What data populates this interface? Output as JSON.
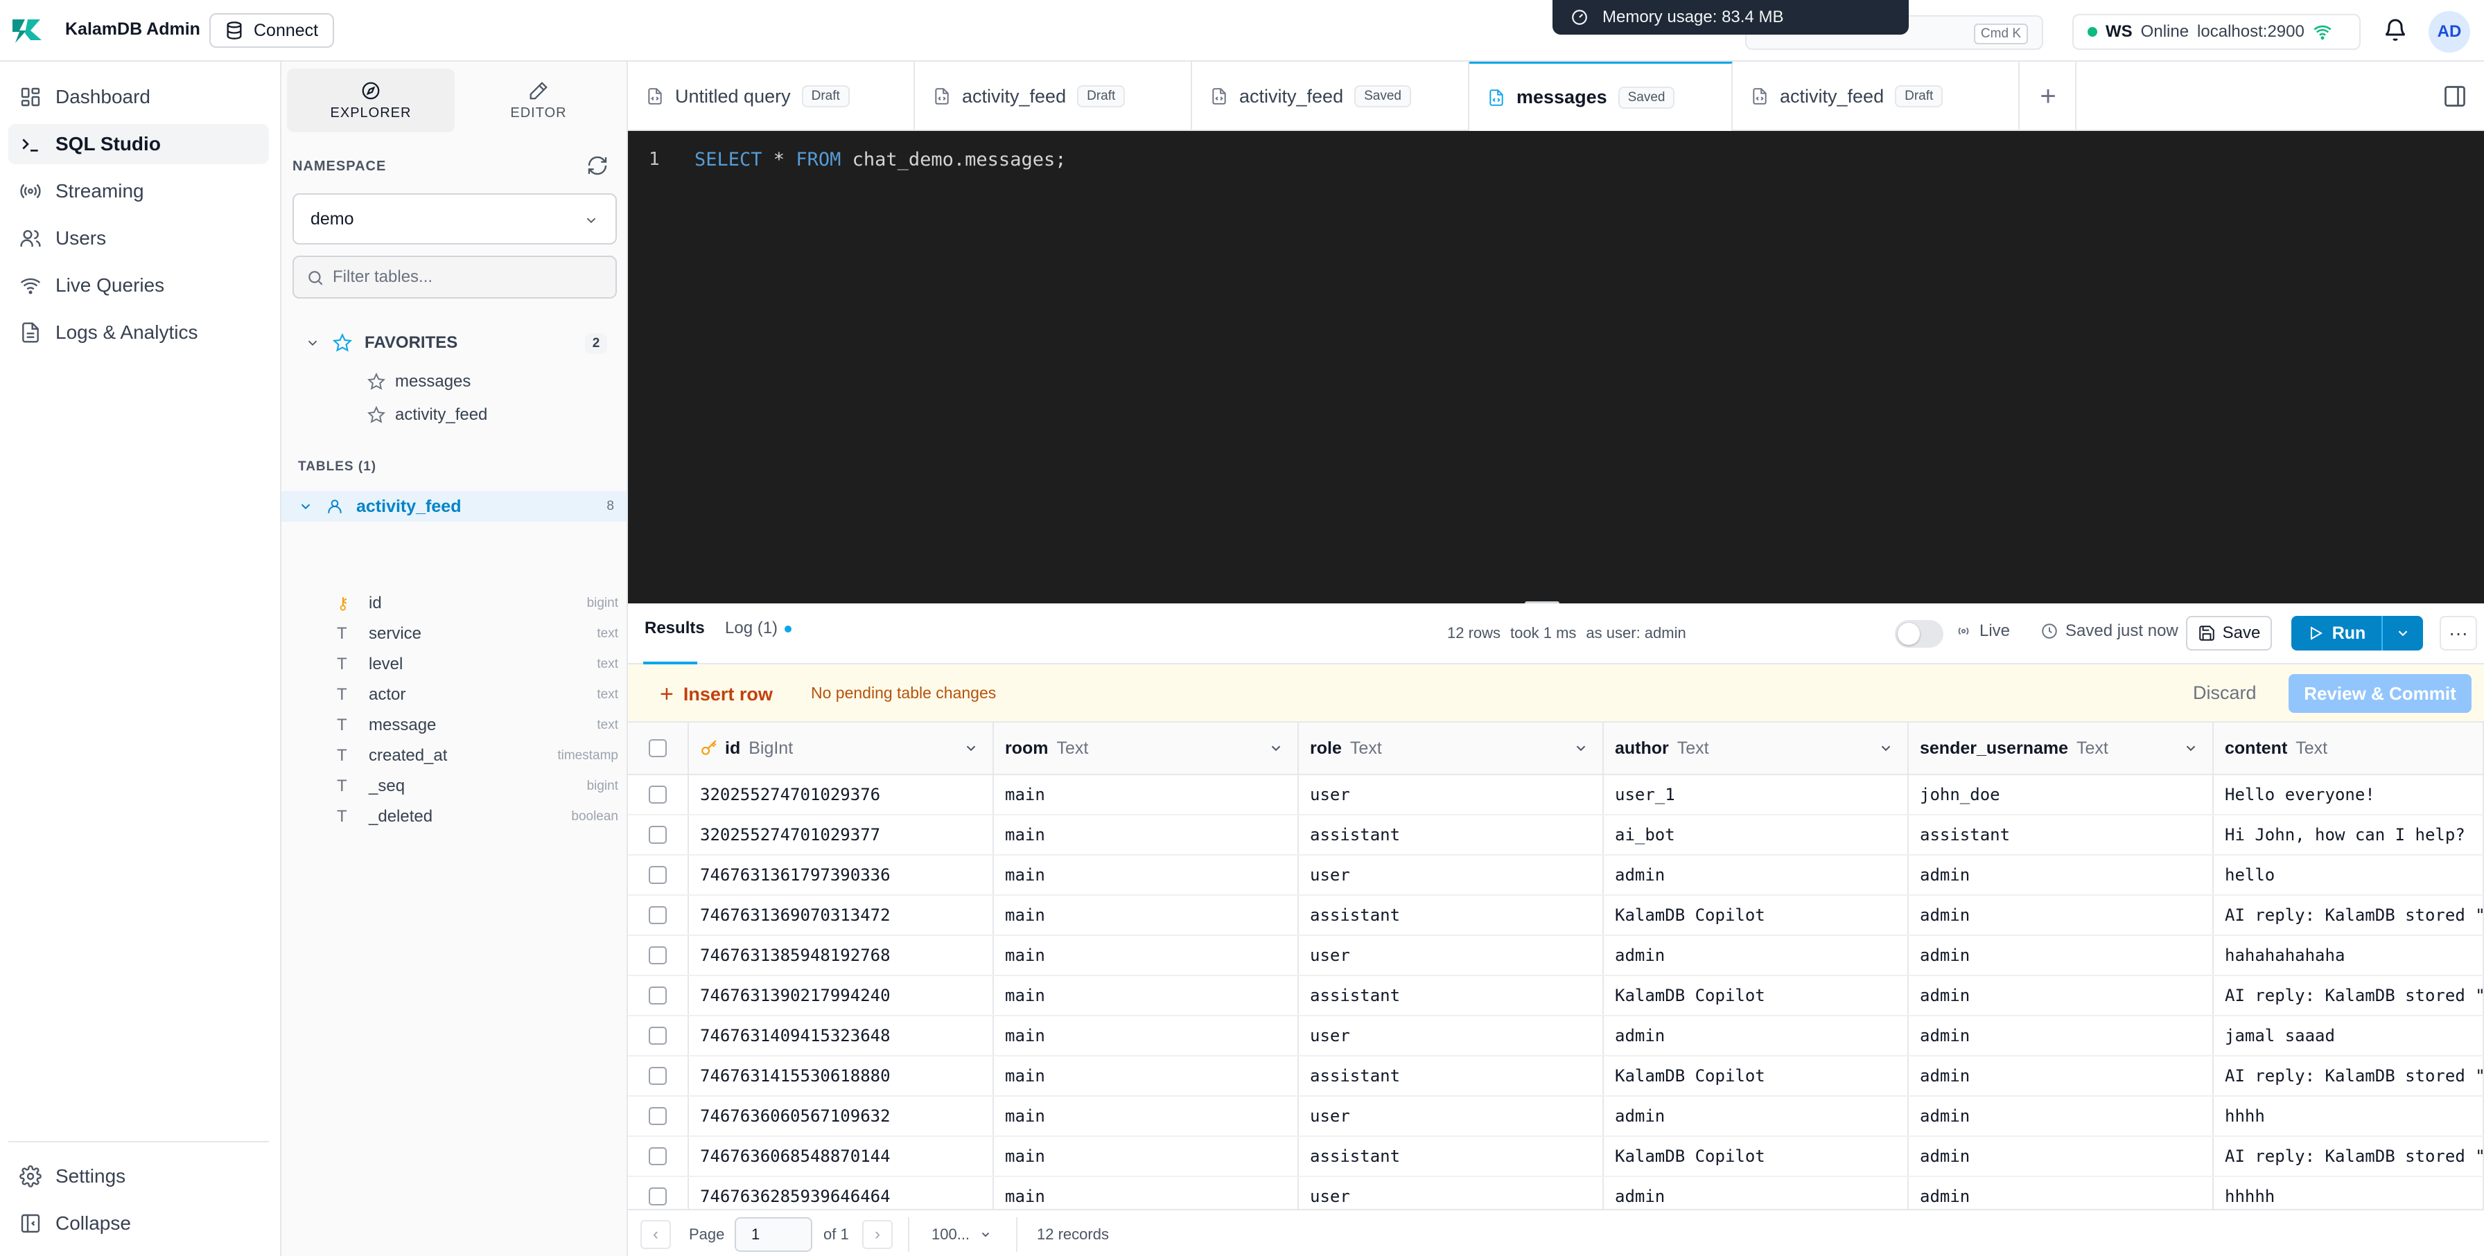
{
  "app": {
    "brand": "KalamDB Admin",
    "connect_label": "Connect",
    "memory_toast": "Memory usage: 83.4 MB",
    "search_shortcut": "Cmd  K",
    "ws": {
      "label": "WS",
      "status": "Online",
      "host": "localhost:2900"
    },
    "avatar_initials": "AD",
    "accent": "#0284c7",
    "online_color": "#10b981"
  },
  "nav": {
    "items": [
      {
        "label": "Dashboard",
        "icon": "grid-icon"
      },
      {
        "label": "SQL Studio",
        "icon": "terminal-icon"
      },
      {
        "label": "Streaming",
        "icon": "radio-icon"
      },
      {
        "label": "Users",
        "icon": "users-icon"
      },
      {
        "label": "Live Queries",
        "icon": "wifi-icon"
      },
      {
        "label": "Logs & Analytics",
        "icon": "file-icon"
      }
    ],
    "settings_label": "Settings",
    "collapse_label": "Collapse"
  },
  "explorer": {
    "tabs": [
      "EXPLORER",
      "EDITOR"
    ],
    "namespace_label": "NAMESPACE",
    "namespace_value": "demo",
    "filter_placeholder": "Filter tables...",
    "favorites_label": "FAVORITES",
    "favorites_count": "2",
    "favorites": [
      "messages",
      "activity_feed"
    ],
    "tables_label": "TABLES (1)",
    "table": {
      "name": "activity_feed",
      "count": "8"
    },
    "columns": [
      {
        "name": "id",
        "type": "bigint",
        "key": true
      },
      {
        "name": "service",
        "type": "text",
        "key": false
      },
      {
        "name": "level",
        "type": "text",
        "key": false
      },
      {
        "name": "actor",
        "type": "text",
        "key": false
      },
      {
        "name": "message",
        "type": "text",
        "key": false
      },
      {
        "name": "created_at",
        "type": "timestamp",
        "key": false
      },
      {
        "name": "_seq",
        "type": "bigint",
        "key": false
      },
      {
        "name": "_deleted",
        "type": "boolean",
        "key": false
      }
    ]
  },
  "tabs": [
    {
      "title": "Untitled query",
      "status": "Draft",
      "active": false
    },
    {
      "title": "activity_feed",
      "status": "Draft",
      "active": false
    },
    {
      "title": "activity_feed",
      "status": "Saved",
      "active": false
    },
    {
      "title": "messages",
      "status": "Saved",
      "active": true
    },
    {
      "title": "activity_feed",
      "status": "Draft",
      "active": false
    }
  ],
  "editor": {
    "line_number": "1",
    "kw_select": "SELECT",
    "star": " * ",
    "kw_from": "FROM",
    "rest": " chat_demo.messages;"
  },
  "results": {
    "tab_results": "Results",
    "tab_log": "Log (1)",
    "rows_stat": "12 rows",
    "took_stat": "took 1 ms",
    "user_stat": "as user: admin",
    "live_label": "Live",
    "saved_label": "Saved just now",
    "save_label": "Save",
    "run_label": "Run",
    "more_label": "···",
    "insert_row_label": "Insert row",
    "pending_label": "No pending table changes",
    "discard_label": "Discard",
    "commit_label": "Review & Commit"
  },
  "grid": {
    "columns": [
      {
        "name": "id",
        "type": "BigInt"
      },
      {
        "name": "room",
        "type": "Text"
      },
      {
        "name": "role",
        "type": "Text"
      },
      {
        "name": "author",
        "type": "Text"
      },
      {
        "name": "sender_username",
        "type": "Text"
      },
      {
        "name": "content",
        "type": "Text"
      }
    ],
    "rows": [
      [
        "320255274701029376",
        "main",
        "user",
        "user_1",
        "john_doe",
        "Hello everyone!"
      ],
      [
        "320255274701029377",
        "main",
        "assistant",
        "ai_bot",
        "assistant",
        "Hi John, how can I help?"
      ],
      [
        "7467631361797390336",
        "main",
        "user",
        "admin",
        "admin",
        "hello"
      ],
      [
        "7467631369070313472",
        "main",
        "assistant",
        "KalamDB Copilot",
        "admin",
        "AI reply: KalamDB stored \"he"
      ],
      [
        "7467631385948192768",
        "main",
        "user",
        "admin",
        "admin",
        "hahahahahaha"
      ],
      [
        "7467631390217994240",
        "main",
        "assistant",
        "KalamDB Copilot",
        "admin",
        "AI reply: KalamDB stored \"ha"
      ],
      [
        "7467631409415323648",
        "main",
        "user",
        "admin",
        "admin",
        "jamal saaad"
      ],
      [
        "7467631415530618880",
        "main",
        "assistant",
        "KalamDB Copilot",
        "admin",
        "AI reply: KalamDB stored \"ja"
      ],
      [
        "7467636060567109632",
        "main",
        "user",
        "admin",
        "admin",
        "hhhh"
      ],
      [
        "7467636068548870144",
        "main",
        "assistant",
        "KalamDB Copilot",
        "admin",
        "AI reply: KalamDB stored \"hh"
      ],
      [
        "7467636285939646464",
        "main",
        "user",
        "admin",
        "admin",
        "hhhhh"
      ]
    ]
  },
  "footer": {
    "page_label": "Page",
    "page_value": "1",
    "of_label": "of 1",
    "page_size": "100...",
    "records": "12 records"
  }
}
